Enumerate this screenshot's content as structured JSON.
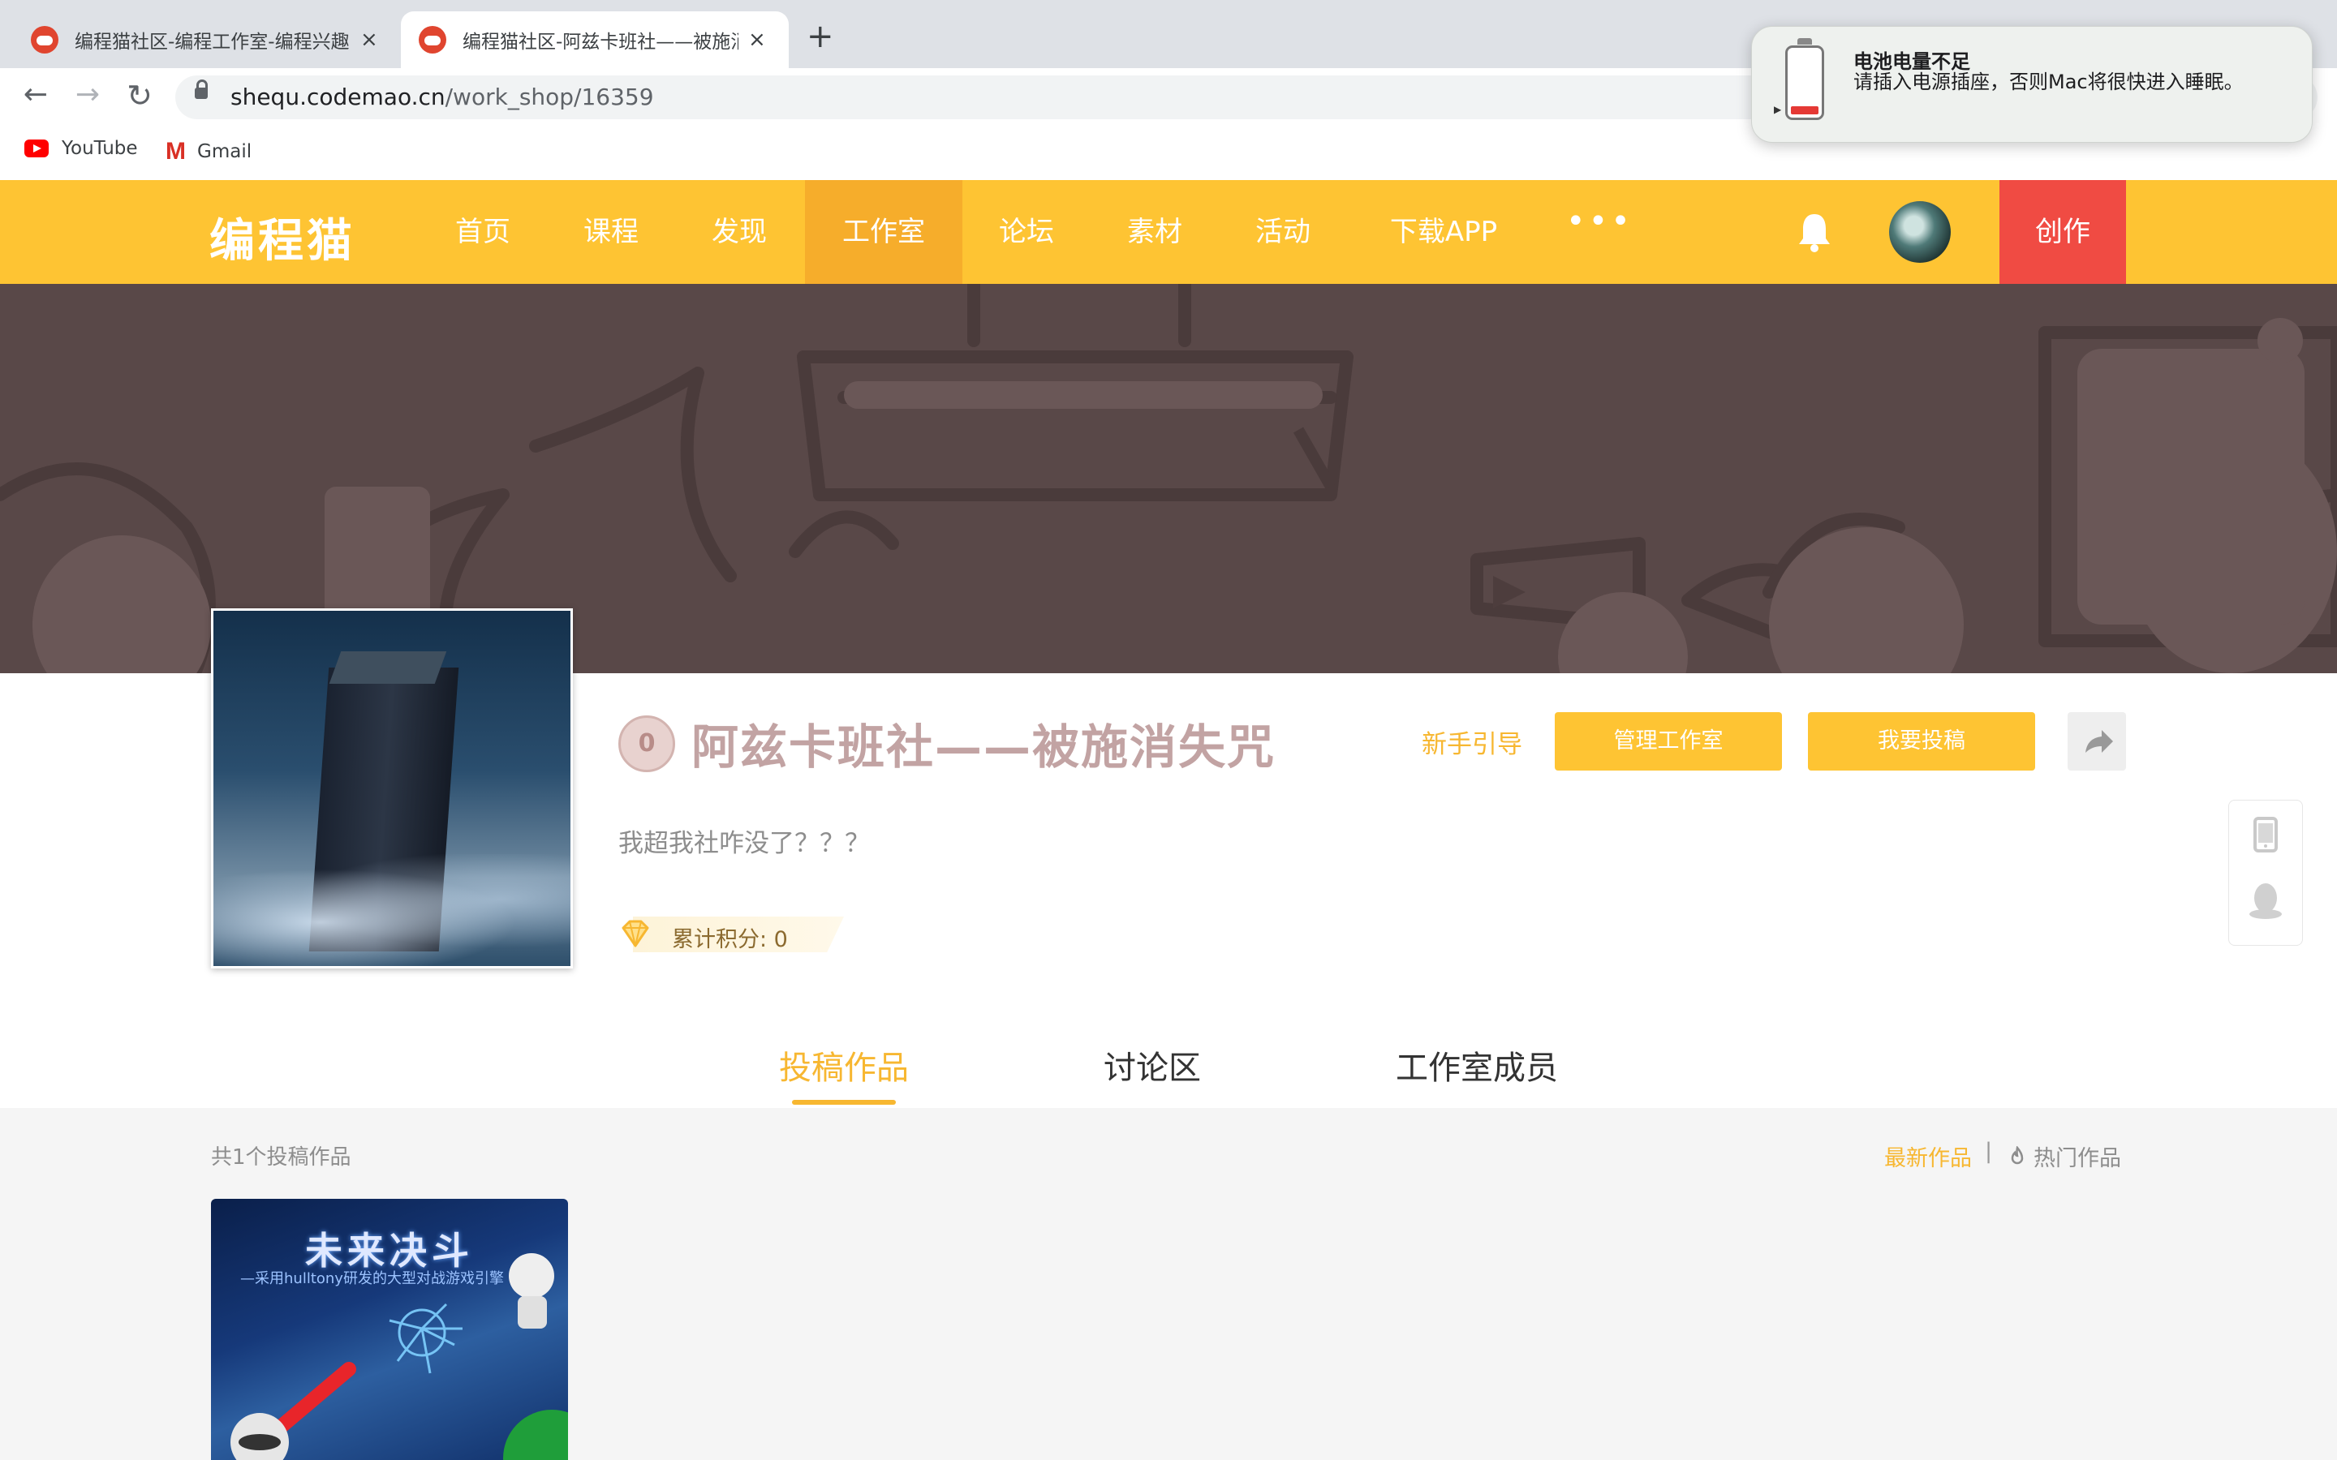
{
  "browser": {
    "tabs": [
      {
        "title": "编程猫社区-编程工作室-编程兴趣",
        "active": false
      },
      {
        "title": "编程猫社区-阿兹卡班社——被施消失咒",
        "active": true
      }
    ],
    "new_tab_label": "+",
    "close_label": "×",
    "url_host": "shequ.codemao.cn",
    "url_path": "/work_shop/16359",
    "bookmarks": [
      {
        "label": "YouTube",
        "icon": "youtube-icon"
      },
      {
        "label": "Gmail",
        "icon": "gmail-icon"
      }
    ]
  },
  "notification": {
    "title": "电池电量不足",
    "body": "请插入电源插座，否则Mac将很快进入睡眠。",
    "icon": "battery-low-icon"
  },
  "site_nav": {
    "logo": "编程猫",
    "items": [
      "首页",
      "课程",
      "发现",
      "工作室",
      "论坛",
      "素材",
      "活动",
      "下载APP"
    ],
    "active": "工作室",
    "more": "•••",
    "create_label": "创作",
    "colors": {
      "bar": "#fec433",
      "active": "#f6ad2b",
      "create": "#f04b43"
    }
  },
  "workshop": {
    "level_badge": "0",
    "title": "阿兹卡班社——被施消失咒",
    "description": "我超我社咋没了？？？",
    "guide_link": "新手引导",
    "manage_button": "管理工作室",
    "submit_button": "我要投稿",
    "score_label": "累计积分: 0"
  },
  "tabs": {
    "items": [
      "投稿作品",
      "讨论区",
      "工作室成员"
    ],
    "active": "投稿作品"
  },
  "works": {
    "count_text": "共1个投稿作品",
    "sort_new": "最新作品",
    "sort_separator": "|",
    "sort_hot": "热门作品",
    "items": [
      {
        "title": "未来决斗",
        "subtitle": "—采用hulltony研发的大型对战游戏引擎"
      }
    ]
  }
}
